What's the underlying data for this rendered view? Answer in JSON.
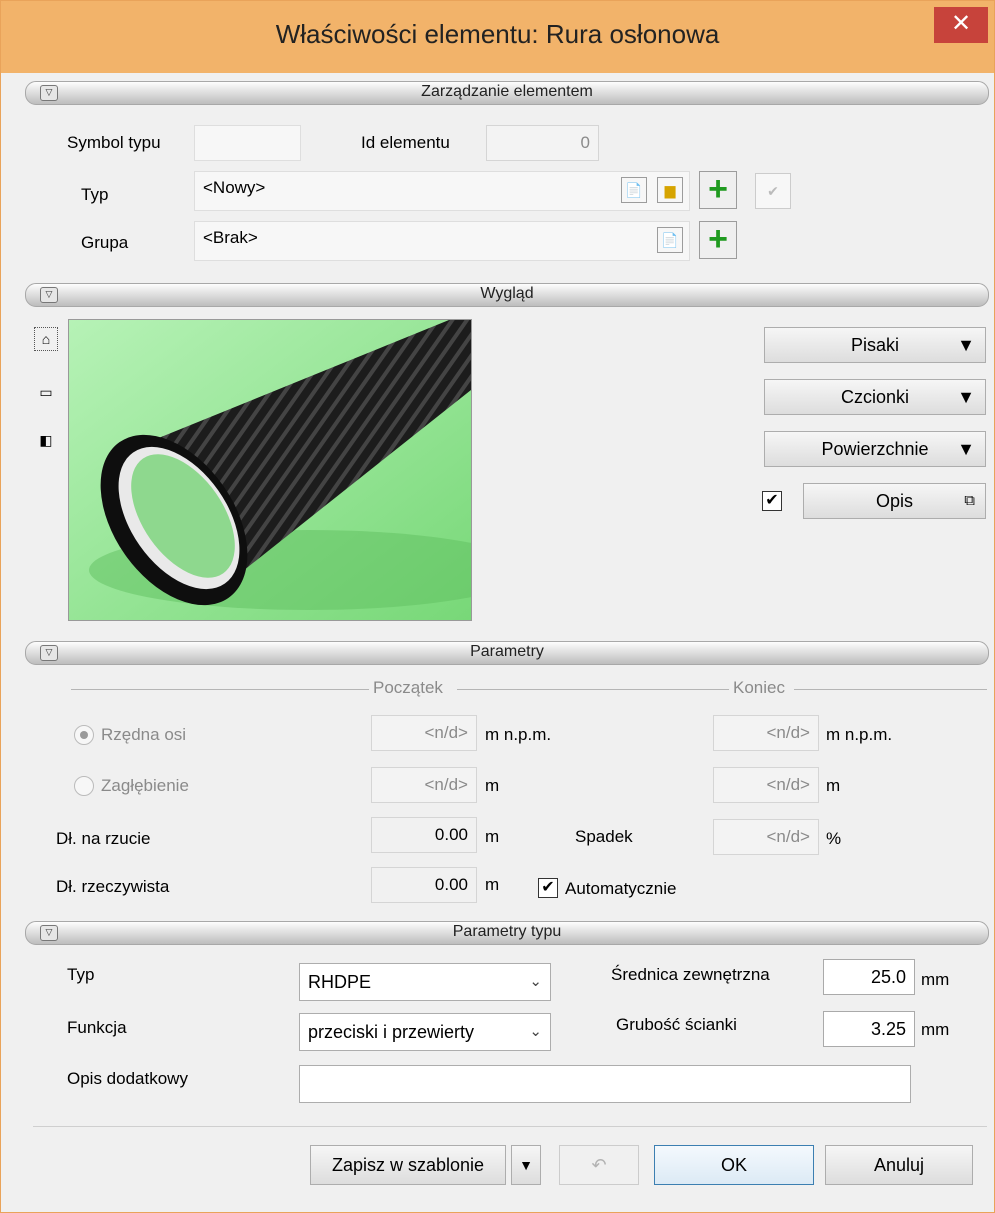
{
  "window": {
    "title": "Właściwości elementu: Rura osłonowa",
    "close_glyph": "✕"
  },
  "sections": {
    "zarzadzanie": "Zarządzanie elementem",
    "wyglad": "Wygląd",
    "parametry": "Parametry",
    "parametry_typu": "Parametry typu"
  },
  "zarzadzanie": {
    "symbol_label": "Symbol typu",
    "symbol_value": "",
    "id_label": "Id elementu",
    "id_value": "0",
    "typ_label": "Typ",
    "typ_value": "<Nowy>",
    "grupa_label": "Grupa",
    "grupa_value": "<Brak>"
  },
  "wyglad": {
    "pisaki": "Pisaki",
    "czcionki": "Czcionki",
    "powierzchnie": "Powierzchnie",
    "opis": "Opis",
    "opis_checked": true,
    "preview_icon": "corrugated-pipe-preview"
  },
  "parametry": {
    "poczatek": "Początek",
    "koniec": "Koniec",
    "rzedna_label": "Rzędna osi",
    "rzedna_start": "<n/d>",
    "rzedna_end": "<n/d>",
    "unit_mnpm": "m n.p.m.",
    "zaglebienie_label": "Zagłębienie",
    "zagl_start": "<n/d>",
    "zagl_end": "<n/d>",
    "unit_m": "m",
    "dl_rzucie_label": "Dł. na rzucie",
    "dl_rzucie_value": "0.00",
    "spadek_label": "Spadek",
    "spadek_value": "<n/d>",
    "unit_pct": "%",
    "dl_rzecz_label": "Dł. rzeczywista",
    "dl_rzecz_value": "0.00",
    "automatycznie": "Automatycznie",
    "automatycznie_checked": true
  },
  "parametry_typu": {
    "typ_label": "Typ",
    "typ_value": "RHDPE",
    "funkcja_label": "Funkcja",
    "funkcja_value": "przeciski i przewierty",
    "opis_dod_label": "Opis dodatkowy",
    "opis_dod_value": "",
    "srednica_label": "Średnica zewnętrzna",
    "srednica_value": "25.0",
    "grubosc_label": "Grubość ścianki",
    "grubosc_value": "3.25",
    "unit_mm": "mm"
  },
  "footer": {
    "zapisz": "Zapisz w szablonie",
    "ok": "OK",
    "anuluj": "Anuluj"
  },
  "colors": {
    "title_bar": "#f2b36a",
    "close": "#c7433b",
    "preview_bg": "#97e697"
  }
}
